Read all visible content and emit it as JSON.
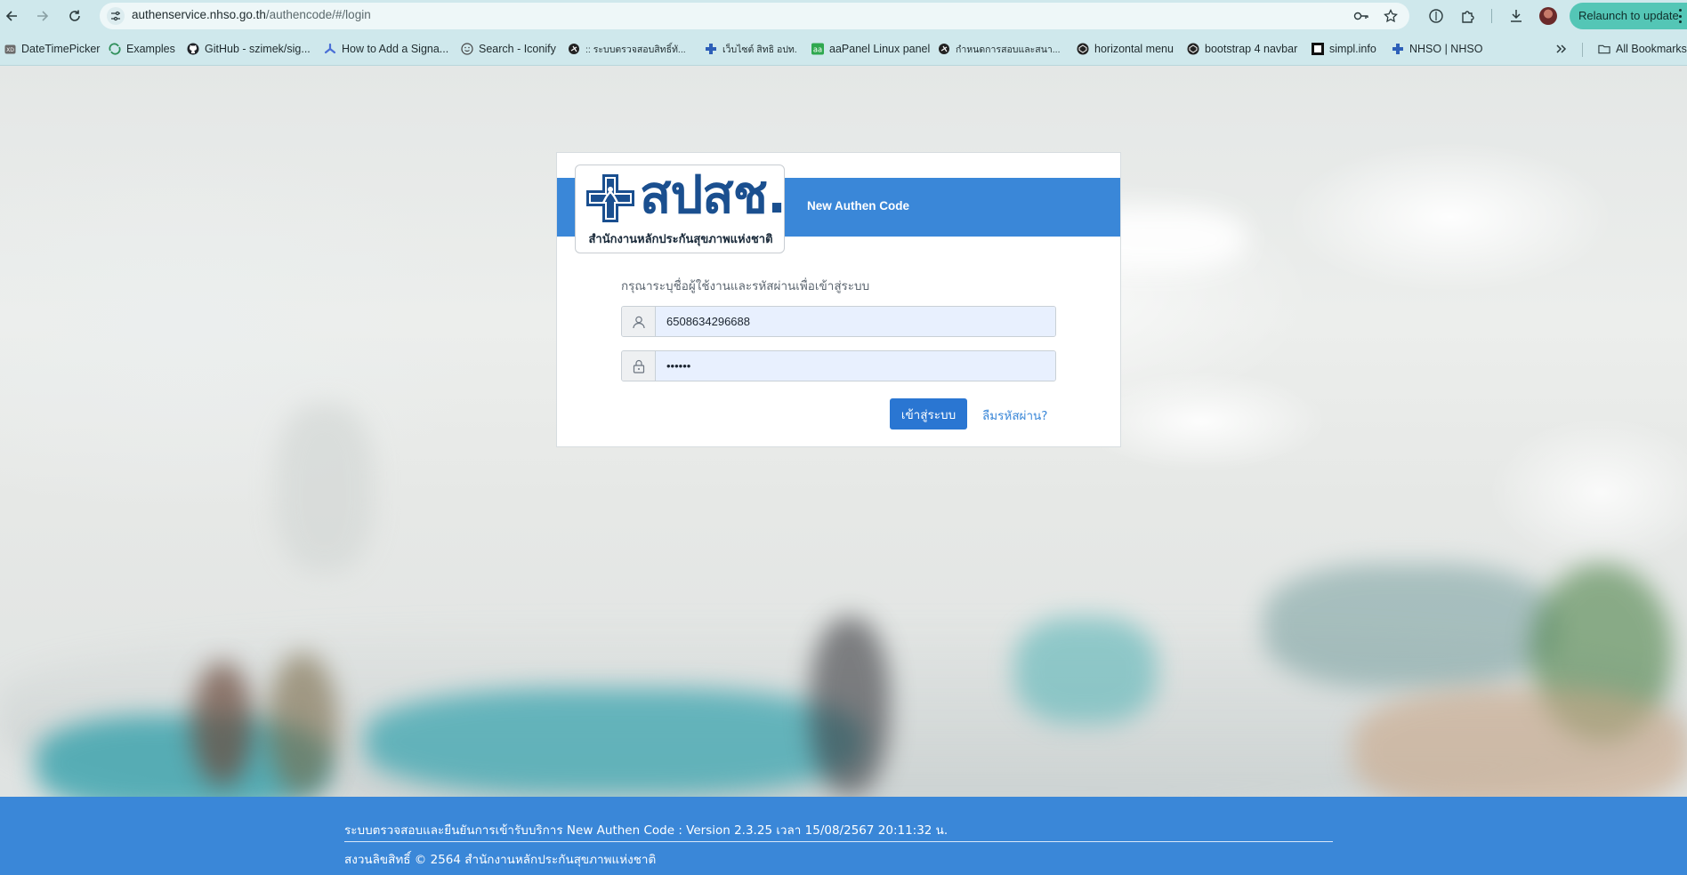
{
  "browser": {
    "url_host": "authenservice.nhso.go.th",
    "url_path": "/authencode/#/login",
    "relaunch_label": "Relaunch to update",
    "bookmarks": [
      {
        "label": "DateTimePicker",
        "icon": "xd-icon"
      },
      {
        "label": "Examples",
        "icon": "examples-icon"
      },
      {
        "label": "GitHub - szimek/sig...",
        "icon": "github-icon"
      },
      {
        "label": "How to Add a Signa...",
        "icon": "signature-icon"
      },
      {
        "label": "Search - Iconify",
        "icon": "iconify-icon"
      },
      {
        "label": ":: ระบบตรวจสอบสิทธิ์ทั...",
        "icon": "globe-icon"
      },
      {
        "label": "เว็บไซต์ สิทธิ อปท.",
        "icon": "nhso-icon"
      },
      {
        "label": "aaPanel Linux panel",
        "icon": "aapanel-icon"
      },
      {
        "label": "กำหนดการสอบและสนา...",
        "icon": "globe-icon"
      },
      {
        "label": "horizontal menu",
        "icon": "codepen-icon"
      },
      {
        "label": "bootstrap 4 navbar",
        "icon": "codepen-icon"
      },
      {
        "label": "simpl.info",
        "icon": "simpl-icon"
      },
      {
        "label": "NHSO | NHSO",
        "icon": "nhso-icon"
      }
    ],
    "all_bookmarks_label": "All Bookmarks"
  },
  "login": {
    "logo_text": "สปสช.",
    "logo_subtitle": "สำนักงานหลักประกันสุขภาพแห่งชาติ",
    "card_title": "New Authen Code",
    "prompt": "กรุณาระบุชื่อผู้ใช้งานและรหัสผ่านเพื่อเข้าสู่ระบบ",
    "username_value": "6508634296688",
    "password_value": "••••••",
    "login_button": "เข้าสู่ระบบ",
    "forgot_link": "ลืมรหัสผ่าน?"
  },
  "footer": {
    "line1": "ระบบตรวจสอบและยืนยันการเข้ารับบริการ New Authen Code : Version 2.3.25 เวลา 15/08/2567 20:11:32 น.",
    "line2": "สงวนลิขสิทธิ์ © 2564 สำนักงานหลักประกันสุขภาพแห่งชาติ"
  },
  "colors": {
    "brand_blue": "#3a87d8",
    "button_blue": "#2a76d2",
    "chrome_bar": "#cfe8ec",
    "relaunch": "#54c6b6"
  }
}
